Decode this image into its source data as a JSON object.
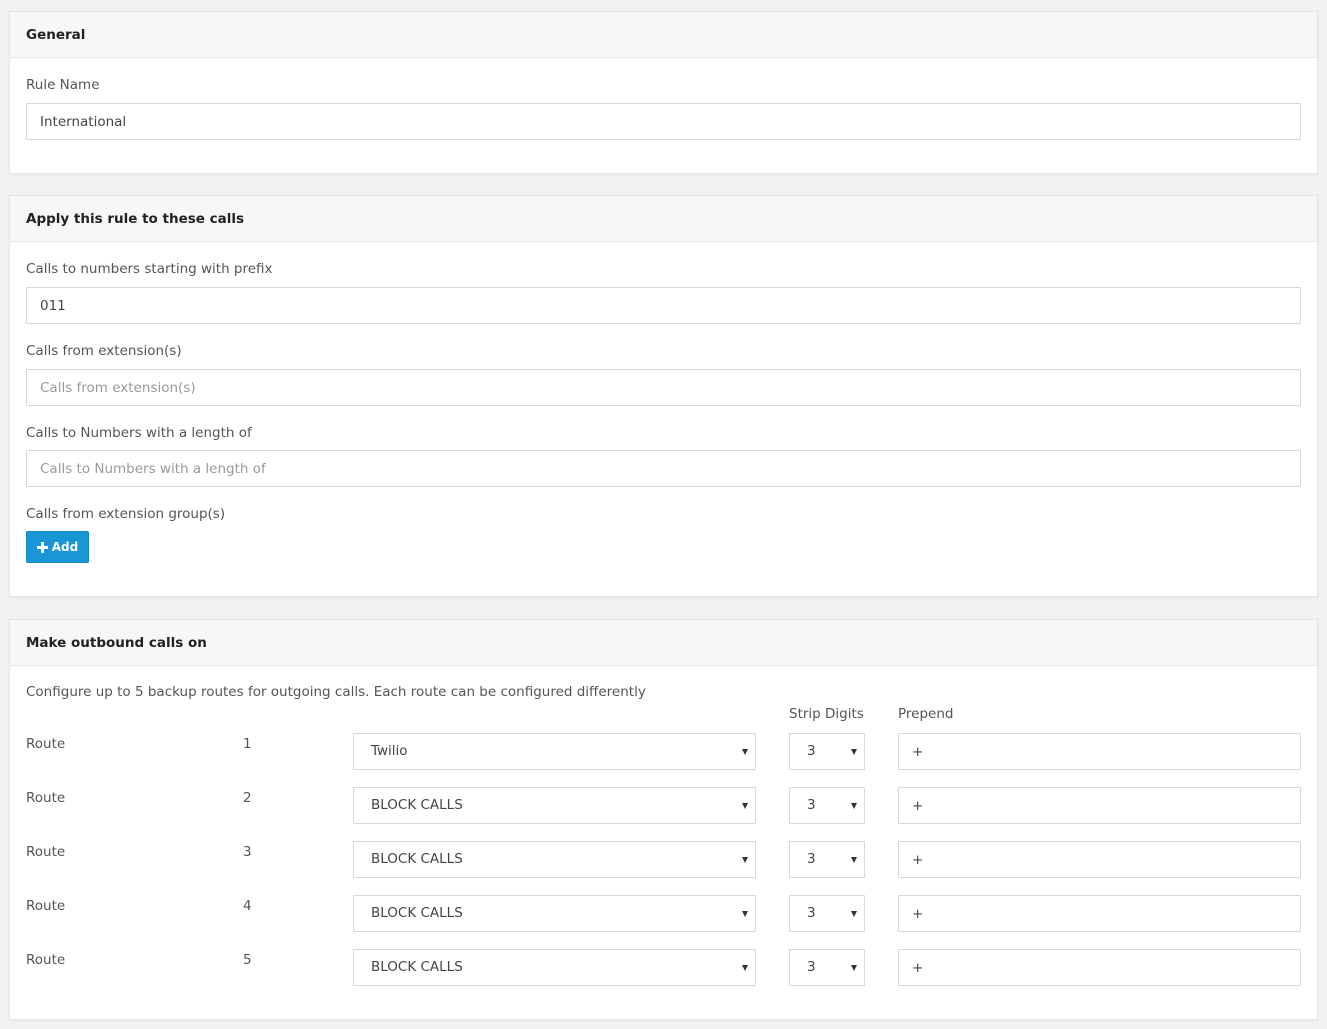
{
  "general": {
    "title": "General",
    "rule_name_label": "Rule Name",
    "rule_name_value": "International"
  },
  "apply": {
    "title": "Apply this rule to these calls",
    "prefix_label": "Calls to numbers starting with prefix",
    "prefix_value": "011",
    "extension_label": "Calls from extension(s)",
    "extension_placeholder": "Calls from extension(s)",
    "length_label": "Calls to Numbers with a length of",
    "length_placeholder": "Calls to Numbers with a length of",
    "group_label": "Calls from extension group(s)",
    "add_label": "Add"
  },
  "outbound": {
    "title": "Make outbound calls on",
    "description": "Configure up to 5 backup routes for outgoing calls. Each route can be configured differently",
    "strip_header": "Strip Digits",
    "prepend_header": "Prepend",
    "routes": [
      {
        "label": "Route",
        "number": "1",
        "trunk": "Twilio",
        "strip": "3",
        "prepend": "+"
      },
      {
        "label": "Route",
        "number": "2",
        "trunk": "BLOCK CALLS",
        "strip": "3",
        "prepend": "+"
      },
      {
        "label": "Route",
        "number": "3",
        "trunk": "BLOCK CALLS",
        "strip": "3",
        "prepend": "+"
      },
      {
        "label": "Route",
        "number": "4",
        "trunk": "BLOCK CALLS",
        "strip": "3",
        "prepend": "+"
      },
      {
        "label": "Route",
        "number": "5",
        "trunk": "BLOCK CALLS",
        "strip": "3",
        "prepend": "+"
      }
    ]
  },
  "colors": {
    "accent": "#1a96d6",
    "page_bg": "#f1f3f3",
    "panel_header_bg": "#f6f7f7"
  }
}
